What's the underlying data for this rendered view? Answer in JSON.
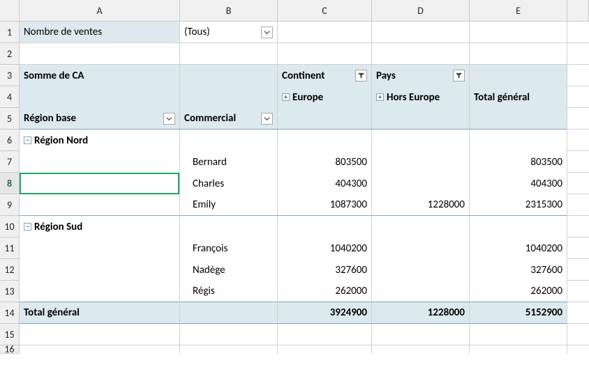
{
  "columns": [
    "A",
    "B",
    "C",
    "D",
    "E"
  ],
  "row_count": 16,
  "active_cell_row": 8,
  "filter_row": {
    "label": "Nombre de ventes",
    "value": "(Tous)"
  },
  "pivot": {
    "values_label": "Somme de CA",
    "col_field_1": "Continent",
    "col_field_2": "Pays",
    "col_item_1": "Europe",
    "col_item_2": "Hors Europe",
    "grand_col": "Total général",
    "row_field_1": "Région base",
    "row_field_2": "Commercial",
    "groups": [
      {
        "name": "Région Nord",
        "rows": [
          {
            "name": "Bernard",
            "europe": "803500",
            "hors": "",
            "total": "803500"
          },
          {
            "name": "Charles",
            "europe": "404300",
            "hors": "",
            "total": "404300"
          },
          {
            "name": "Emily",
            "europe": "1087300",
            "hors": "1228000",
            "total": "2315300"
          }
        ]
      },
      {
        "name": "Région Sud",
        "rows": [
          {
            "name": "François",
            "europe": "1040200",
            "hors": "",
            "total": "1040200"
          },
          {
            "name": "Nadège",
            "europe": "327600",
            "hors": "",
            "total": "327600"
          },
          {
            "name": "Régis",
            "europe": "262000",
            "hors": "",
            "total": "262000"
          }
        ]
      }
    ],
    "grand_row": {
      "label": "Total général",
      "europe": "3924900",
      "hors": "1228000",
      "total": "5152900"
    }
  },
  "chart_data": {
    "type": "table",
    "title": "Somme de CA",
    "columns": [
      "Région base",
      "Commercial",
      "Europe",
      "Hors Europe",
      "Total général"
    ],
    "rows": [
      [
        "Région Nord",
        "Bernard",
        803500,
        null,
        803500
      ],
      [
        "Région Nord",
        "Charles",
        404300,
        null,
        404300
      ],
      [
        "Région Nord",
        "Emily",
        1087300,
        1228000,
        2315300
      ],
      [
        "Région Sud",
        "François",
        1040200,
        null,
        1040200
      ],
      [
        "Région Sud",
        "Nadège",
        327600,
        null,
        327600
      ],
      [
        "Région Sud",
        "Régis",
        262000,
        null,
        262000
      ],
      [
        "Total général",
        "",
        3924900,
        1228000,
        5152900
      ]
    ]
  }
}
